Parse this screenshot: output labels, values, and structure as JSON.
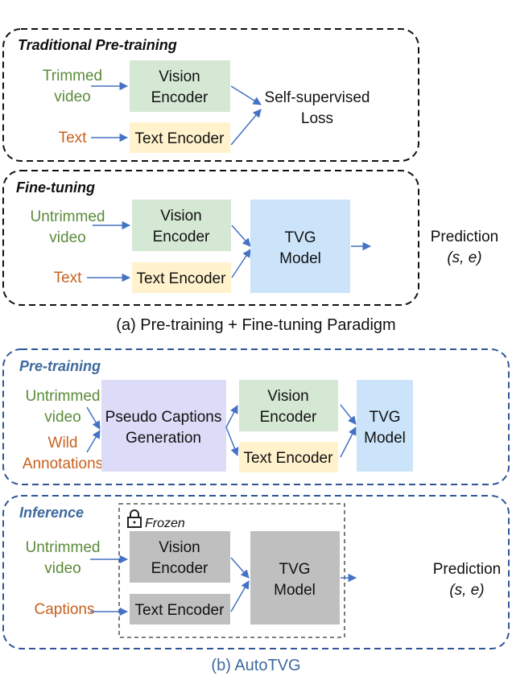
{
  "colors": {
    "green_text": "#5b8a3a",
    "orange_text": "#c8611f",
    "blue_title": "#3d6a9e",
    "arrow": "#4472c4",
    "vision_fill": "#d5e8d4",
    "text_fill": "#fff2cc",
    "tvg_fill": "#cce4fa",
    "pseudo_fill": "#dcdcf8",
    "frozen_fill": "#bfbfbf",
    "dash_black": "#111111",
    "dash_blue": "#2f5597"
  },
  "top_cut_text": "...",
  "panel_a": {
    "traditional": {
      "title": "Traditional Pre-training",
      "input1": [
        "Trimmed",
        "video"
      ],
      "input2": "Text",
      "vision": [
        "Vision",
        "Encoder"
      ],
      "text_encoder": "Text Encoder",
      "loss": [
        "Self-supervised",
        "Loss"
      ]
    },
    "finetune": {
      "title": "Fine-tuning",
      "input1": [
        "Untrimmed",
        "video"
      ],
      "input2": "Text",
      "vision": [
        "Vision",
        "Encoder"
      ],
      "text_encoder": "Text Encoder",
      "tvg": [
        "TVG",
        "Model"
      ],
      "prediction": [
        "Prediction",
        "(s, e)"
      ]
    },
    "caption": "(a) Pre-training + Fine-tuning Paradigm"
  },
  "panel_b": {
    "pretrain": {
      "title": "Pre-training",
      "input1": [
        "Untrimmed",
        "video"
      ],
      "input2": [
        "Wild",
        "Annotations"
      ],
      "pseudo": [
        "Pseudo Captions",
        "Generation"
      ],
      "vision": [
        "Vision",
        "Encoder"
      ],
      "text_encoder": "Text Encoder",
      "tvg": [
        "TVG",
        "Model"
      ]
    },
    "inference": {
      "title": "Inference",
      "frozen_label": "Frozen",
      "input1": [
        "Untrimmed",
        "video"
      ],
      "input2": "Captions",
      "vision": [
        "Vision",
        "Encoder"
      ],
      "text_encoder": "Text Encoder",
      "tvg": [
        "TVG",
        "Model"
      ],
      "prediction": [
        "Prediction",
        "(s, e)"
      ]
    },
    "caption": "(b) AutoTVG"
  }
}
